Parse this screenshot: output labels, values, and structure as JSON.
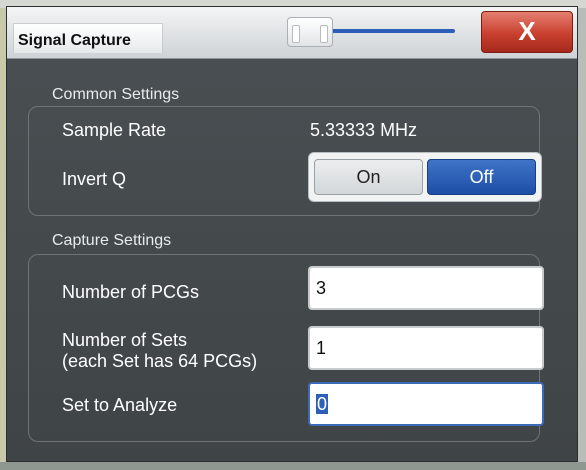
{
  "dialog": {
    "title": "Signal Capture",
    "close_label": "X"
  },
  "common_settings": {
    "heading": "Common Settings",
    "sample_rate_label": "Sample Rate",
    "sample_rate_value": "5.33333 MHz",
    "invert_q_label": "Invert Q",
    "invert_q_on": "On",
    "invert_q_off": "Off",
    "invert_q_selected": "Off"
  },
  "capture_settings": {
    "heading": "Capture Settings",
    "num_pcgs_label": "Number of PCGs",
    "num_pcgs_value": "3",
    "num_sets_label_line1": "Number of Sets",
    "num_sets_label_line2": "(each Set has 64 PCGs)",
    "num_sets_value": "1",
    "set_to_analyze_label": "Set to Analyze",
    "set_to_analyze_value": "0"
  },
  "colors": {
    "accent": "#1d4ea6",
    "close": "#c9402f",
    "panel": "#454a4d"
  }
}
